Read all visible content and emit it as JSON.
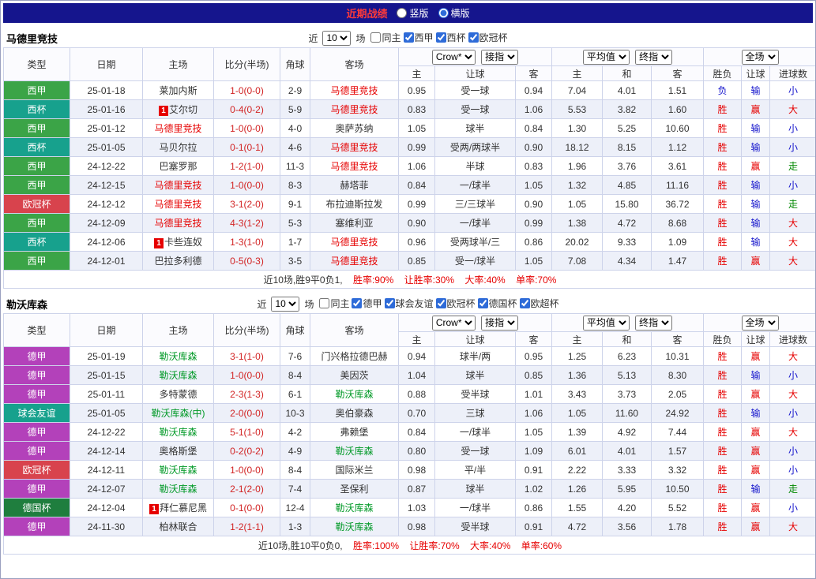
{
  "topbar": {
    "title": "近期战绩",
    "layout_options": [
      {
        "label": "竖版",
        "selected": false
      },
      {
        "label": "横版",
        "selected": true
      }
    ]
  },
  "labels": {
    "near": "近",
    "matches": "场"
  },
  "header": {
    "main_cols": [
      "类型",
      "日期",
      "主场",
      "比分(半场)",
      "角球",
      "客场"
    ],
    "sub_cols": [
      "主",
      "让球",
      "客",
      "主",
      "和",
      "客",
      "胜负",
      "让球",
      "进球数"
    ],
    "selects": {
      "bookmaker": "Crow*",
      "bookmaker_mode": "接指",
      "average": "平均值",
      "average_mode": "终指",
      "scope": "全场"
    }
  },
  "colors": {
    "type_bg": {
      "西甲": "#3ba447",
      "西杯": "#17a18d",
      "欧冠杯": "#d8434d",
      "德甲": "#b341ba",
      "球会友谊": "#17a18d",
      "德国杯": "#1f7e3e"
    },
    "result_text": {
      "胜": "#e60000",
      "负": "#1414cc",
      "赢": "#e60000",
      "输": "#1414cc",
      "大": "#e60000",
      "小": "#1414cc",
      "走": "#008800"
    },
    "score_text": "#d22424",
    "focus_team": {
      "马德里竞技": "#e60000",
      "勒沃库森": "#009926"
    }
  },
  "sections": [
    {
      "team": "马德里竞技",
      "focus": "马德里竞技",
      "count": "10",
      "filters": [
        {
          "label": "同主",
          "checked": false
        },
        {
          "label": "西甲",
          "checked": true
        },
        {
          "label": "西杯",
          "checked": true
        },
        {
          "label": "欧冠杯",
          "checked": true
        }
      ],
      "rows": [
        {
          "type": "西甲",
          "date": "25-01-18",
          "home": "莱加内斯",
          "score": "1-0(0-0)",
          "corner": "2-9",
          "away": "马德里竞技",
          "odds": [
            "0.95",
            "受一球",
            "0.94"
          ],
          "avg": [
            "7.04",
            "4.01",
            "1.51"
          ],
          "results": [
            "负",
            "输",
            "小"
          ]
        },
        {
          "type": "西杯",
          "date": "25-01-16",
          "home": "艾尔切",
          "home_badge": "1",
          "score": "0-4(0-2)",
          "corner": "5-9",
          "away": "马德里竞技",
          "odds": [
            "0.83",
            "受一球",
            "1.06"
          ],
          "avg": [
            "5.53",
            "3.82",
            "1.60"
          ],
          "results": [
            "胜",
            "赢",
            "大"
          ]
        },
        {
          "type": "西甲",
          "date": "25-01-12",
          "home": "马德里竞技",
          "score": "1-0(0-0)",
          "corner": "4-0",
          "away": "奥萨苏纳",
          "odds": [
            "1.05",
            "球半",
            "0.84"
          ],
          "avg": [
            "1.30",
            "5.25",
            "10.60"
          ],
          "results": [
            "胜",
            "输",
            "小"
          ]
        },
        {
          "type": "西杯",
          "date": "25-01-05",
          "home": "马贝尔拉",
          "score": "0-1(0-1)",
          "corner": "4-6",
          "away": "马德里竞技",
          "odds": [
            "0.99",
            "受两/两球半",
            "0.90"
          ],
          "avg": [
            "18.12",
            "8.15",
            "1.12"
          ],
          "results": [
            "胜",
            "输",
            "小"
          ]
        },
        {
          "type": "西甲",
          "date": "24-12-22",
          "home": "巴塞罗那",
          "score": "1-2(1-0)",
          "corner": "11-3",
          "away": "马德里竞技",
          "odds": [
            "1.06",
            "半球",
            "0.83"
          ],
          "avg": [
            "1.96",
            "3.76",
            "3.61"
          ],
          "results": [
            "胜",
            "赢",
            "走"
          ]
        },
        {
          "type": "西甲",
          "date": "24-12-15",
          "home": "马德里竞技",
          "score": "1-0(0-0)",
          "corner": "8-3",
          "away": "赫塔菲",
          "odds": [
            "0.84",
            "一/球半",
            "1.05"
          ],
          "avg": [
            "1.32",
            "4.85",
            "11.16"
          ],
          "results": [
            "胜",
            "输",
            "小"
          ]
        },
        {
          "type": "欧冠杯",
          "date": "24-12-12",
          "home": "马德里竞技",
          "score": "3-1(2-0)",
          "corner": "9-1",
          "away": "布拉迪斯拉发",
          "odds": [
            "0.99",
            "三/三球半",
            "0.90"
          ],
          "avg": [
            "1.05",
            "15.80",
            "36.72"
          ],
          "results": [
            "胜",
            "输",
            "走"
          ]
        },
        {
          "type": "西甲",
          "date": "24-12-09",
          "home": "马德里竞技",
          "score": "4-3(1-2)",
          "corner": "5-3",
          "away": "塞维利亚",
          "odds": [
            "0.90",
            "一/球半",
            "0.99"
          ],
          "avg": [
            "1.38",
            "4.72",
            "8.68"
          ],
          "results": [
            "胜",
            "输",
            "大"
          ]
        },
        {
          "type": "西杯",
          "date": "24-12-06",
          "home": "卡些连奴",
          "home_badge": "1",
          "score": "1-3(1-0)",
          "corner": "1-7",
          "away": "马德里竞技",
          "odds": [
            "0.96",
            "受两球半/三",
            "0.86"
          ],
          "avg": [
            "20.02",
            "9.33",
            "1.09"
          ],
          "results": [
            "胜",
            "输",
            "大"
          ]
        },
        {
          "type": "西甲",
          "date": "24-12-01",
          "home": "巴拉多利德",
          "score": "0-5(0-3)",
          "corner": "3-5",
          "away": "马德里竞技",
          "odds": [
            "0.85",
            "受一/球半",
            "1.05"
          ],
          "avg": [
            "7.08",
            "4.34",
            "1.47"
          ],
          "results": [
            "胜",
            "赢",
            "大"
          ]
        }
      ],
      "footer": {
        "prefix": "近10场,胜9平0负1,",
        "stats": [
          "胜率:90%",
          "让胜率:30%",
          "大率:40%",
          "单率:70%"
        ]
      }
    },
    {
      "team": "勒沃库森",
      "focus": "勒沃库森",
      "count": "10",
      "filters": [
        {
          "label": "同主",
          "checked": false
        },
        {
          "label": "德甲",
          "checked": true
        },
        {
          "label": "球会友谊",
          "checked": true
        },
        {
          "label": "欧冠杯",
          "checked": true
        },
        {
          "label": "德国杯",
          "checked": true
        },
        {
          "label": "欧超杯",
          "checked": true
        }
      ],
      "rows": [
        {
          "type": "德甲",
          "date": "25-01-19",
          "home": "勒沃库森",
          "score": "3-1(1-0)",
          "corner": "7-6",
          "away": "门兴格拉德巴赫",
          "odds": [
            "0.94",
            "球半/两",
            "0.95"
          ],
          "avg": [
            "1.25",
            "6.23",
            "10.31"
          ],
          "results": [
            "胜",
            "赢",
            "大"
          ]
        },
        {
          "type": "德甲",
          "date": "25-01-15",
          "home": "勒沃库森",
          "score": "1-0(0-0)",
          "corner": "8-4",
          "away": "美因茨",
          "odds": [
            "1.04",
            "球半",
            "0.85"
          ],
          "avg": [
            "1.36",
            "5.13",
            "8.30"
          ],
          "results": [
            "胜",
            "输",
            "小"
          ]
        },
        {
          "type": "德甲",
          "date": "25-01-11",
          "home": "多特蒙德",
          "score": "2-3(1-3)",
          "corner": "6-1",
          "away": "勒沃库森",
          "odds": [
            "0.88",
            "受半球",
            "1.01"
          ],
          "avg": [
            "3.43",
            "3.73",
            "2.05"
          ],
          "results": [
            "胜",
            "赢",
            "大"
          ]
        },
        {
          "type": "球会友谊",
          "date": "25-01-05",
          "home": "勒沃库森(中)",
          "score": "2-0(0-0)",
          "corner": "10-3",
          "away": "奥伯豪森",
          "odds": [
            "0.70",
            "三球",
            "1.06"
          ],
          "avg": [
            "1.05",
            "11.60",
            "24.92"
          ],
          "results": [
            "胜",
            "输",
            "小"
          ]
        },
        {
          "type": "德甲",
          "date": "24-12-22",
          "home": "勒沃库森",
          "score": "5-1(1-0)",
          "corner": "4-2",
          "away": "弗赖堡",
          "odds": [
            "0.84",
            "一/球半",
            "1.05"
          ],
          "avg": [
            "1.39",
            "4.92",
            "7.44"
          ],
          "results": [
            "胜",
            "赢",
            "大"
          ]
        },
        {
          "type": "德甲",
          "date": "24-12-14",
          "home": "奥格斯堡",
          "score": "0-2(0-2)",
          "corner": "4-9",
          "away": "勒沃库森",
          "odds": [
            "0.80",
            "受一球",
            "1.09"
          ],
          "avg": [
            "6.01",
            "4.01",
            "1.57"
          ],
          "results": [
            "胜",
            "赢",
            "小"
          ]
        },
        {
          "type": "欧冠杯",
          "date": "24-12-11",
          "home": "勒沃库森",
          "score": "1-0(0-0)",
          "corner": "8-4",
          "away": "国际米兰",
          "odds": [
            "0.98",
            "平/半",
            "0.91"
          ],
          "avg": [
            "2.22",
            "3.33",
            "3.32"
          ],
          "results": [
            "胜",
            "赢",
            "小"
          ]
        },
        {
          "type": "德甲",
          "date": "24-12-07",
          "home": "勒沃库森",
          "score": "2-1(2-0)",
          "corner": "7-4",
          "away": "圣保利",
          "odds": [
            "0.87",
            "球半",
            "1.02"
          ],
          "avg": [
            "1.26",
            "5.95",
            "10.50"
          ],
          "results": [
            "胜",
            "输",
            "走"
          ]
        },
        {
          "type": "德国杯",
          "date": "24-12-04",
          "home": "拜仁慕尼黑",
          "home_badge": "1",
          "score": "0-1(0-0)",
          "corner": "12-4",
          "away": "勒沃库森",
          "odds": [
            "1.03",
            "一/球半",
            "0.86"
          ],
          "avg": [
            "1.55",
            "4.20",
            "5.52"
          ],
          "results": [
            "胜",
            "赢",
            "小"
          ]
        },
        {
          "type": "德甲",
          "date": "24-11-30",
          "home": "柏林联合",
          "score": "1-2(1-1)",
          "corner": "1-3",
          "away": "勒沃库森",
          "odds": [
            "0.98",
            "受半球",
            "0.91"
          ],
          "avg": [
            "4.72",
            "3.56",
            "1.78"
          ],
          "results": [
            "胜",
            "赢",
            "大"
          ]
        }
      ],
      "footer": {
        "prefix": "近10场,胜10平0负0,",
        "stats": [
          "胜率:100%",
          "让胜率:70%",
          "大率:40%",
          "单率:60%"
        ]
      }
    }
  ]
}
